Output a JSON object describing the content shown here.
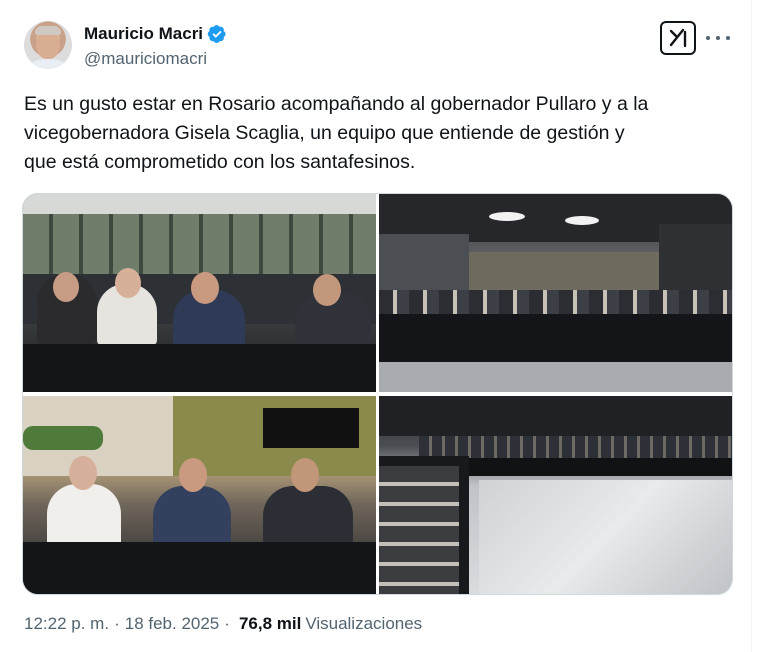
{
  "author": {
    "display_name": "Mauricio Macri",
    "handle": "@mauriciomacri",
    "verified": true
  },
  "icons": {
    "avatar": "profile-photo",
    "verified": "verified-badge-icon",
    "grok": "grok-icon",
    "more": "more-icon"
  },
  "colors": {
    "verified_blue": "#1d9bf0",
    "secondary_text": "#536471",
    "primary_text": "#0f1419"
  },
  "tweet": {
    "text": "Es un gusto estar en Rosario acompañando al gobernador Pullaro y a la\nvicegobernadora Gisela Scaglia, un equipo que entiende de gestión y\nque está comprometido con los santafesinos."
  },
  "media": {
    "count": 4
  },
  "meta": {
    "time": "12:22 p. m.",
    "separator": "·",
    "date": "18 feb. 2025",
    "views_count": "76,8 mil",
    "views_label": "Visualizaciones"
  }
}
